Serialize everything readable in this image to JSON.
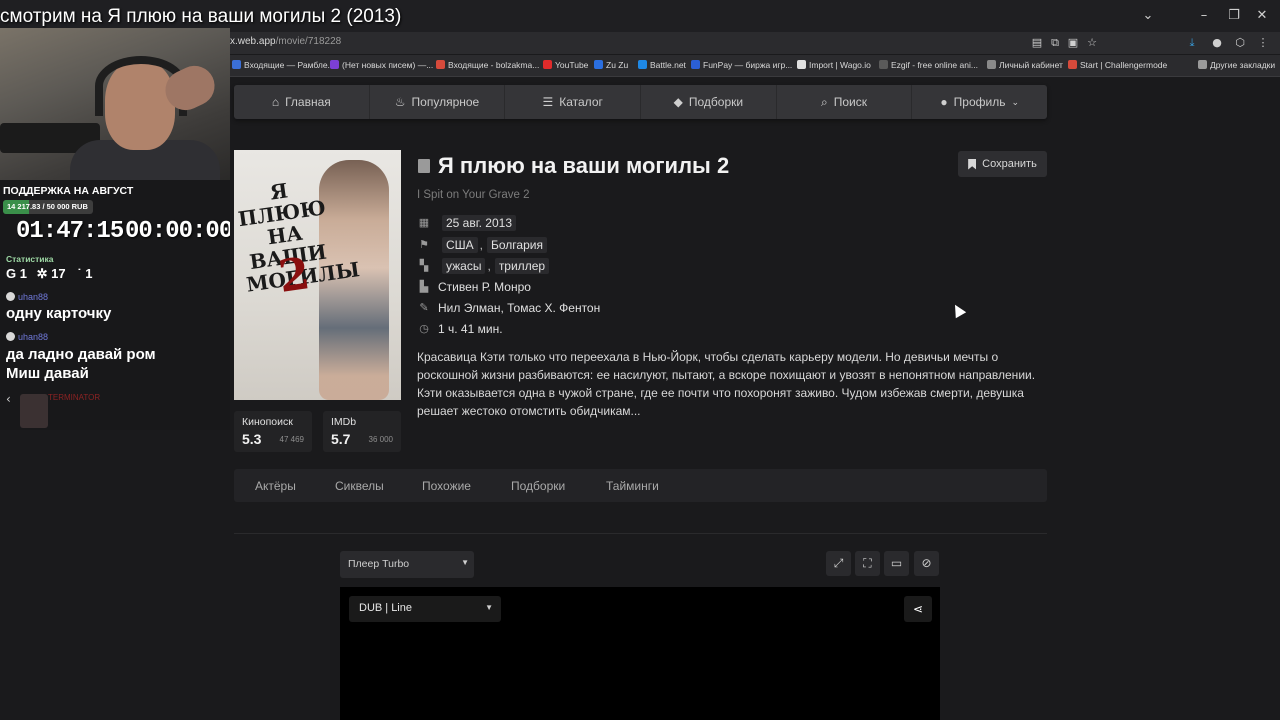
{
  "stream": {
    "title": "смотрим на Я плюю на ваши могилы 2 (2013)",
    "support_title": "ПОДДЕРЖКА НА АВГУСТ",
    "support_progress": "14 217.83 / 50 000 RUB",
    "support_fraction": 0.284,
    "timer_left": "01:47:15",
    "timer_right": "00:00:00",
    "stats_title": "Статистика",
    "stats_1": "1",
    "stats_2": "17",
    "stats_3": "1",
    "chat": [
      {
        "user": "uhan88",
        "message": "одну карточку"
      },
      {
        "user": "uhan88",
        "message": "да ладно давай ром\nМиш давай"
      }
    ],
    "terminator": "TERMINATOR"
  },
  "browser": {
    "url_host": "x.web.app",
    "url_path": "/movie/718228",
    "bookmarks": [
      {
        "label": "Входящие — Рамбле...",
        "icon_color": "#3b6fd6"
      },
      {
        "label": "(Нет новых писем) —...",
        "icon_color": "#7b3fd6"
      },
      {
        "label": "Входящие - bolzakma...",
        "icon_color": "#d64a3b"
      },
      {
        "label": "YouTube",
        "icon_color": "#e02b2b"
      },
      {
        "label": "Zu Zu",
        "icon_color": "#2b6fe0"
      },
      {
        "label": "Battle.net",
        "icon_color": "#1e88e5"
      },
      {
        "label": "FunPay — биржа игр...",
        "icon_color": "#2b5fd6"
      },
      {
        "label": "Import | Wago.io",
        "icon_color": "#e0e0e0"
      },
      {
        "label": "Ezgif - free online ani...",
        "icon_color": "#5a5a5a"
      },
      {
        "label": "Личный кабинет",
        "icon_color": "#8a8a8a"
      },
      {
        "label": "Start | Challengermode",
        "icon_color": "#d64a3b"
      },
      {
        "label": "Другие закладки",
        "icon_color": "#9a9a9a"
      }
    ]
  },
  "nav": [
    {
      "label": "Главная",
      "icon": "home-icon"
    },
    {
      "label": "Популярное",
      "icon": "fire-icon"
    },
    {
      "label": "Каталог",
      "icon": "layers-icon"
    },
    {
      "label": "Подборки",
      "icon": "shapes-icon"
    },
    {
      "label": "Поиск",
      "icon": "search-icon"
    },
    {
      "label": "Профиль",
      "icon": "user-icon"
    }
  ],
  "movie": {
    "title": "Я плюю на ваши могилы 2",
    "original_title": "I Spit on Your Grave 2",
    "save_label": "Сохранить",
    "date": "25 авг. 2013",
    "countries": [
      "США",
      "Болгария"
    ],
    "genres": [
      "ужасы",
      "триллер"
    ],
    "director": "Стивен Р. Монро",
    "writers": "Нил Элман, Томас Х. Фентон",
    "duration": "1 ч. 41 мин.",
    "description": "Красавица Кэти только что переехала в Нью-Йорк, чтобы сделать карьеру модели. Но девичьи мечты о роскошной жизни разбиваются: ее насилуют, пытают, а вскоре похищают и увозят в непонятном направлении. Кэти оказывается одна в чужой стране, где ее почти что похоронят заживо. Чудом избежав смерти, девушка решает жестоко отомстить обидчикам...",
    "poster_title": "Я ПЛЮЮ НА ВАШИ МОГИЛЫ",
    "poster_number": "2",
    "ratings": [
      {
        "name": "Кинопоиск",
        "value": "5.3",
        "votes": "47 469"
      },
      {
        "name": "IMDb",
        "value": "5.7",
        "votes": "36 000"
      }
    ]
  },
  "tabs": [
    "Актёры",
    "Сиквелы",
    "Похожие",
    "Подборки",
    "Тайминги"
  ],
  "player": {
    "player_select": "Плеер Turbo",
    "dub_select": "DUB | Line"
  }
}
